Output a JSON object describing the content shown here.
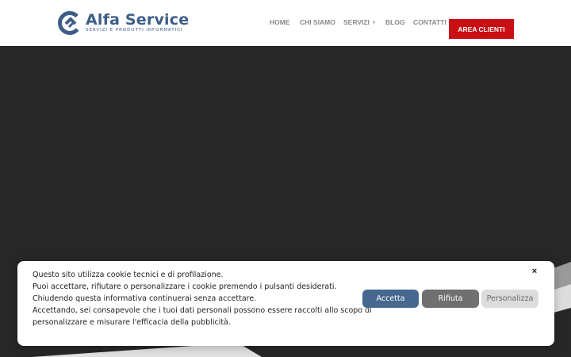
{
  "brand": {
    "name": "Alfa Service",
    "tagline": "SERVIZI E PRODOTTI INFORMATICI",
    "color": "#3d5d86"
  },
  "nav": {
    "items": [
      {
        "label": "HOME"
      },
      {
        "label": "CHI SIAMO"
      },
      {
        "label": "SERVIZI",
        "has_submenu": true
      },
      {
        "label": "BLOG"
      },
      {
        "label": "CONTATTI"
      }
    ],
    "cta_label": "AREA CLIENTI",
    "cta_color": "#c90f14"
  },
  "hero": {
    "background_color": "#272727"
  },
  "cookie_banner": {
    "lines": [
      "Questo sito utilizza cookie tecnici e di profilazione.",
      "Puoi accettare, rifiutare o personalizzare i cookie premendo i pulsanti desiderati.",
      "Chiudendo questa informativa continuerai senza accettare.",
      "Accettando, sei consapevole che i tuoi dati personali possono essere raccolti allo scopo di",
      "personalizzare e misurare l'efficacia della pubblicità."
    ],
    "close_icon": "×",
    "accept_label": "Accetta",
    "reject_label": "Rifiuta",
    "customize_label": "Personalizza",
    "accept_color": "#46688f",
    "reject_color": "#707070",
    "customize_color": "#dcdcdc"
  }
}
